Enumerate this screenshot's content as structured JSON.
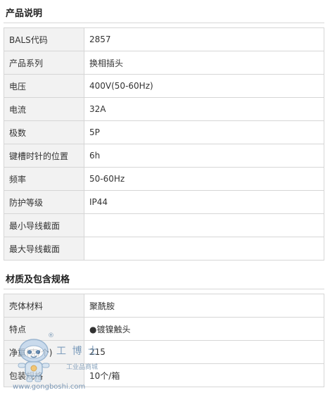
{
  "section1": {
    "title": "产品说明",
    "rows": [
      {
        "label": "BALS代码",
        "value": "2857"
      },
      {
        "label": "产品系列",
        "value": "换相插头"
      },
      {
        "label": "电压",
        "value": "400V(50-60Hz)"
      },
      {
        "label": "电流",
        "value": "32A"
      },
      {
        "label": "极数",
        "value": "5P"
      },
      {
        "label": "键槽时针的位置",
        "value": "6h"
      },
      {
        "label": "频率",
        "value": "50-60Hz"
      },
      {
        "label": "防护等级",
        "value": "IP44"
      },
      {
        "label": "最小导线截面",
        "value": ""
      },
      {
        "label": "最大导线截面",
        "value": ""
      }
    ]
  },
  "section2": {
    "title": "材质及包含规格",
    "rows": [
      {
        "label": "壳体材料",
        "value": "聚酰胺"
      },
      {
        "label": "特点",
        "value": "●镀镍触头"
      },
      {
        "label": "净重(克/个)",
        "value": "215"
      },
      {
        "label": "包装规格",
        "value": "10个/箱"
      }
    ]
  },
  "watermark": {
    "registered": "®",
    "brand": "工 博 士",
    "subtitle": "工业品商城",
    "url": "www.gongboshi.com"
  }
}
